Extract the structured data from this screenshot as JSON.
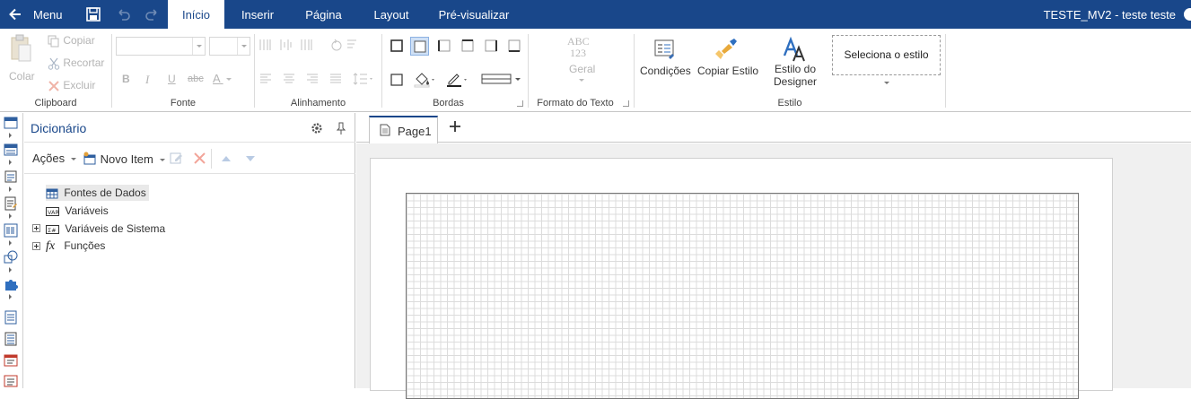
{
  "topbar": {
    "menu_label": "Menu",
    "tabs": [
      "Início",
      "Inserir",
      "Página",
      "Layout",
      "Pré-visualizar"
    ],
    "active_tab": "Início",
    "document_title": "TESTE_MV2 - teste teste"
  },
  "ribbon": {
    "clipboard": {
      "label": "Clipboard",
      "paste": "Colar",
      "copy": "Copiar",
      "cut": "Recortar",
      "delete": "Excluir"
    },
    "font": {
      "label": "Fonte",
      "bold": "B",
      "italic": "I",
      "underline": "U",
      "strike": "abc",
      "color": "A"
    },
    "alignment": {
      "label": "Alinhamento"
    },
    "borders": {
      "label": "Bordas"
    },
    "text_format": {
      "label": "Formato do Texto",
      "sample_1": "ABC",
      "sample_2": "123",
      "value": "Geral"
    },
    "style": {
      "label": "Estilo",
      "conditions": "Condições",
      "copy_style": "Copiar Estilo",
      "designer_style_1": "Estilo do",
      "designer_style_2": "Designer",
      "select_style": "Seleciona o estilo"
    }
  },
  "dictionary": {
    "title": "Dicionário",
    "actions": "Ações",
    "new_item": "Novo Item",
    "tree": [
      {
        "label": "Fontes de Dados",
        "icon": "datasource-icon"
      },
      {
        "label": "Variáveis",
        "icon": "variable-icon"
      },
      {
        "label": "Variáveis de Sistema",
        "icon": "system-variable-icon"
      },
      {
        "label": "Funções",
        "icon": "function-icon",
        "glyph": "fx"
      }
    ]
  },
  "page_tabs": {
    "current": "Page1"
  },
  "colors": {
    "brand": "#19478a",
    "canvas": "#f0f0f0"
  }
}
